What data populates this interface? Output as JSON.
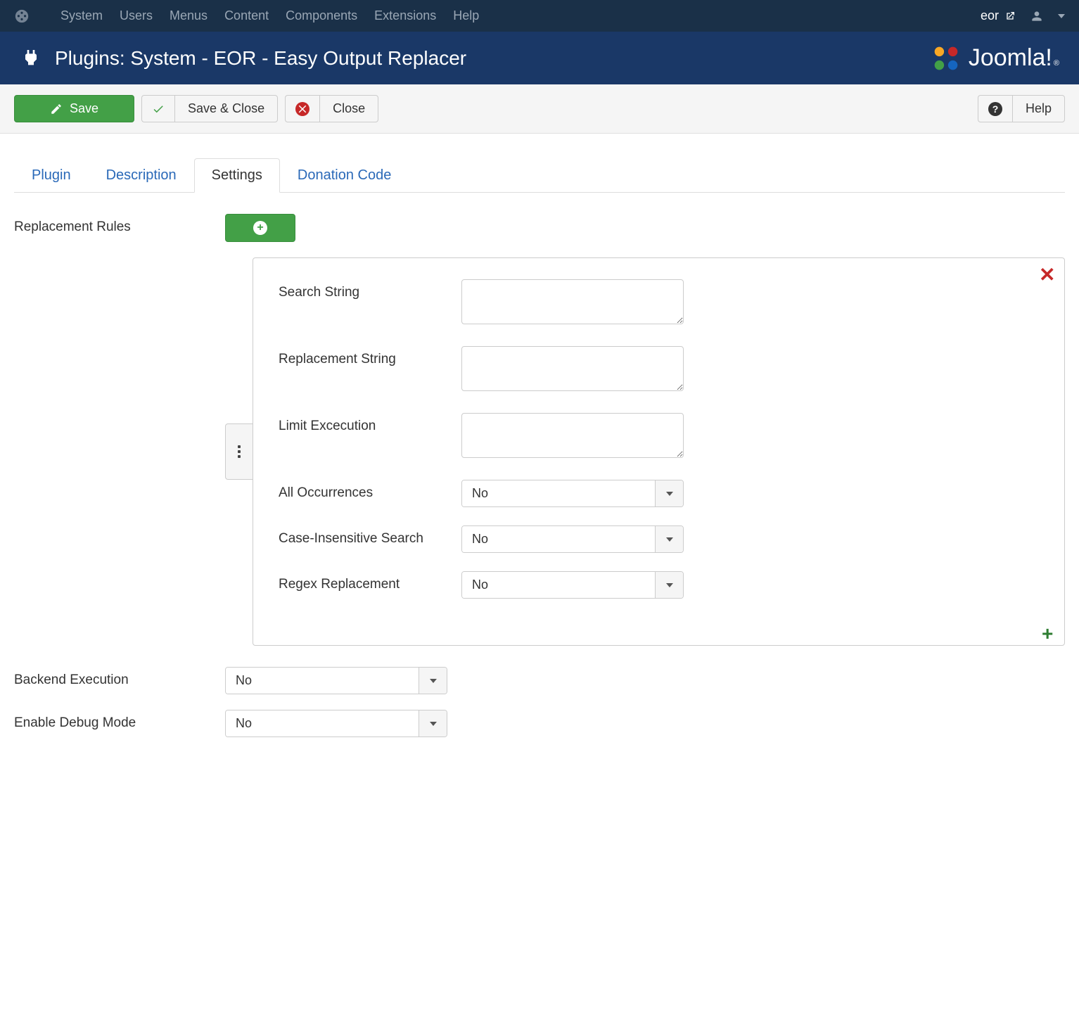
{
  "topbar": {
    "menu": [
      "System",
      "Users",
      "Menus",
      "Content",
      "Components",
      "Extensions",
      "Help"
    ],
    "site_name": "eor"
  },
  "header": {
    "title": "Plugins: System - EOR - Easy Output Replacer",
    "brand": "Joomla!"
  },
  "toolbar": {
    "save": "Save",
    "save_close": "Save & Close",
    "close": "Close",
    "help": "Help"
  },
  "tabs": [
    "Plugin",
    "Description",
    "Settings",
    "Donation Code"
  ],
  "active_tab": "Settings",
  "labels": {
    "replacement_rules": "Replacement Rules",
    "backend_execution": "Backend Execution",
    "enable_debug": "Enable Debug Mode"
  },
  "rule_panel": {
    "search_string": "Search String",
    "replacement_string": "Replacement String",
    "limit_execution": "Limit Excecution",
    "all_occurrences": "All Occurrences",
    "case_insensitive": "Case-Insensitive Search",
    "regex_replacement": "Regex Replacement"
  },
  "values": {
    "search_string": "",
    "replacement_string": "",
    "limit_execution": "",
    "all_occurrences": "No",
    "case_insensitive": "No",
    "regex_replacement": "No",
    "backend_execution": "No",
    "enable_debug": "No"
  }
}
